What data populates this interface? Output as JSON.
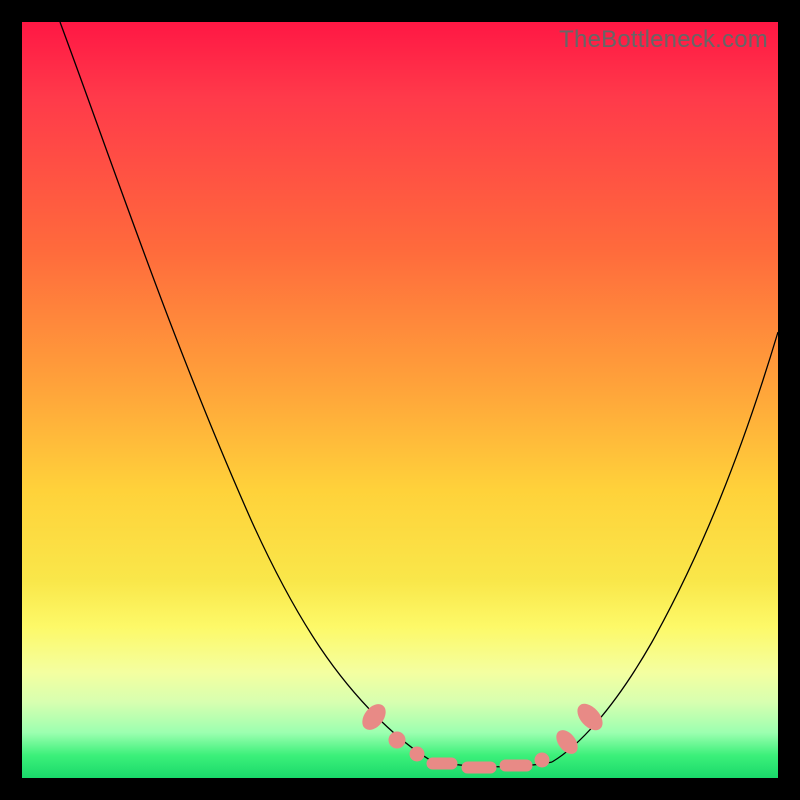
{
  "watermark": "TheBottleneck.com",
  "colors": {
    "frame": "#000000",
    "gradient_top": "#ff1744",
    "gradient_mid1": "#ff6a3c",
    "gradient_mid2": "#ffd23a",
    "gradient_mid3": "#fdf968",
    "gradient_bottom": "#19d96a",
    "curve": "#000000",
    "bead": "#e88a86"
  },
  "chart_data": {
    "type": "line",
    "title": "",
    "xlabel": "",
    "ylabel": "",
    "xlim": [
      0,
      100
    ],
    "ylim": [
      0,
      100
    ],
    "series": [
      {
        "name": "left-branch",
        "x": [
          5,
          10,
          15,
          20,
          25,
          30,
          35,
          40,
          45,
          49,
          52
        ],
        "y": [
          100,
          80,
          62,
          48,
          36,
          26,
          18,
          11,
          6,
          3,
          1
        ]
      },
      {
        "name": "valley-floor",
        "x": [
          52,
          56,
          60,
          64,
          68
        ],
        "y": [
          1,
          0.5,
          0.5,
          0.5,
          1
        ]
      },
      {
        "name": "right-branch",
        "x": [
          68,
          72,
          76,
          80,
          84,
          88,
          92,
          96,
          100
        ],
        "y": [
          1,
          4,
          9,
          15,
          22,
          30,
          39,
          49,
          60
        ]
      }
    ],
    "markers": [
      {
        "name": "left-descent-bead-1",
        "x": 46,
        "y": 6,
        "shape": "oval-diag"
      },
      {
        "name": "left-descent-bead-2",
        "x": 49,
        "y": 3,
        "shape": "circle"
      },
      {
        "name": "left-descent-bead-3",
        "x": 51,
        "y": 1.5,
        "shape": "circle"
      },
      {
        "name": "valley-bead-1",
        "x": 54,
        "y": 0.8,
        "shape": "pill"
      },
      {
        "name": "valley-bead-2",
        "x": 59,
        "y": 0.5,
        "shape": "pill"
      },
      {
        "name": "valley-bead-3",
        "x": 64,
        "y": 0.7,
        "shape": "pill"
      },
      {
        "name": "right-ascent-bead-1",
        "x": 68,
        "y": 1.5,
        "shape": "circle"
      },
      {
        "name": "right-ascent-bead-2",
        "x": 71,
        "y": 4,
        "shape": "oval-diag"
      },
      {
        "name": "right-ascent-bead-3",
        "x": 74,
        "y": 8,
        "shape": "oval-diag"
      }
    ]
  }
}
